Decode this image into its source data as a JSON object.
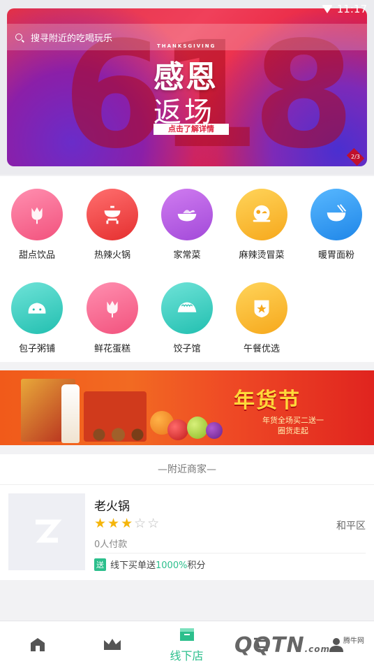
{
  "status_bar": {
    "time": "11:17"
  },
  "banner": {
    "search_placeholder": "搜寻附近的吃喝玩乐",
    "big_number": "618",
    "small_caption": "THANKSGIVING",
    "title_line1": "感恩",
    "title_line2": "返场",
    "cta": "点击了解详情",
    "pager": "2/3"
  },
  "categories": [
    {
      "label": "甜点饮品",
      "icon": "tulip-icon",
      "color_from": "#ff8fb0",
      "color_to": "#f2527d"
    },
    {
      "label": "热辣火锅",
      "icon": "hotpot-icon",
      "color_from": "#ff6f6f",
      "color_to": "#e52f2f"
    },
    {
      "label": "家常菜",
      "icon": "dish-bowl-icon",
      "color_from": "#d07cf0",
      "color_to": "#a249d9"
    },
    {
      "label": "麻辣烫冒菜",
      "icon": "spicy-bowl-icon",
      "color_from": "#ffd45a",
      "color_to": "#f6a81c"
    },
    {
      "label": "暖胃面粉",
      "icon": "noodle-bowl-icon",
      "color_from": "#58b8ff",
      "color_to": "#1f86e8"
    },
    {
      "label": "包子粥铺",
      "icon": "bun-icon",
      "color_from": "#6fe3d8",
      "color_to": "#22bfb0"
    },
    {
      "label": "鲜花蛋糕",
      "icon": "flower-icon",
      "color_from": "#ff8fb0",
      "color_to": "#f2527d"
    },
    {
      "label": "饺子馆",
      "icon": "dumpling-icon",
      "color_from": "#6fe3d8",
      "color_to": "#22bfb0"
    },
    {
      "label": "午餐优选",
      "icon": "star-badge-icon",
      "color_from": "#ffd45a",
      "color_to": "#f6a81c"
    }
  ],
  "promo": {
    "title": "年货节",
    "line1": "年货全场买二送一",
    "line2": "圈货走起"
  },
  "nearby": {
    "header": "—附近商家—",
    "shops": [
      {
        "name": "老火锅",
        "rating": 3,
        "max_rating": 5,
        "stars_on": "★★★",
        "stars_off": "☆☆",
        "area": "和平区",
        "paid_count": "0人付款",
        "promo_tag": "送",
        "promo_prefix": "线下买单送",
        "promo_highlight": "1000%",
        "promo_suffix": "积分"
      }
    ]
  },
  "bottom_nav": {
    "items": [
      {
        "label": "",
        "icon": "home-icon"
      },
      {
        "label": "",
        "icon": "crown-icon"
      },
      {
        "label": "线下店",
        "icon": "store-icon"
      },
      {
        "label": "",
        "icon": "cart-icon"
      },
      {
        "label": "",
        "icon": "profile-icon"
      }
    ]
  },
  "watermark": {
    "text": "腾牛网",
    "logo": "QQTN",
    "suffix": ".com"
  },
  "colors": {
    "accent": "#2cbf8c",
    "star": "#f5b50a",
    "banner_red": "#e8203e"
  }
}
